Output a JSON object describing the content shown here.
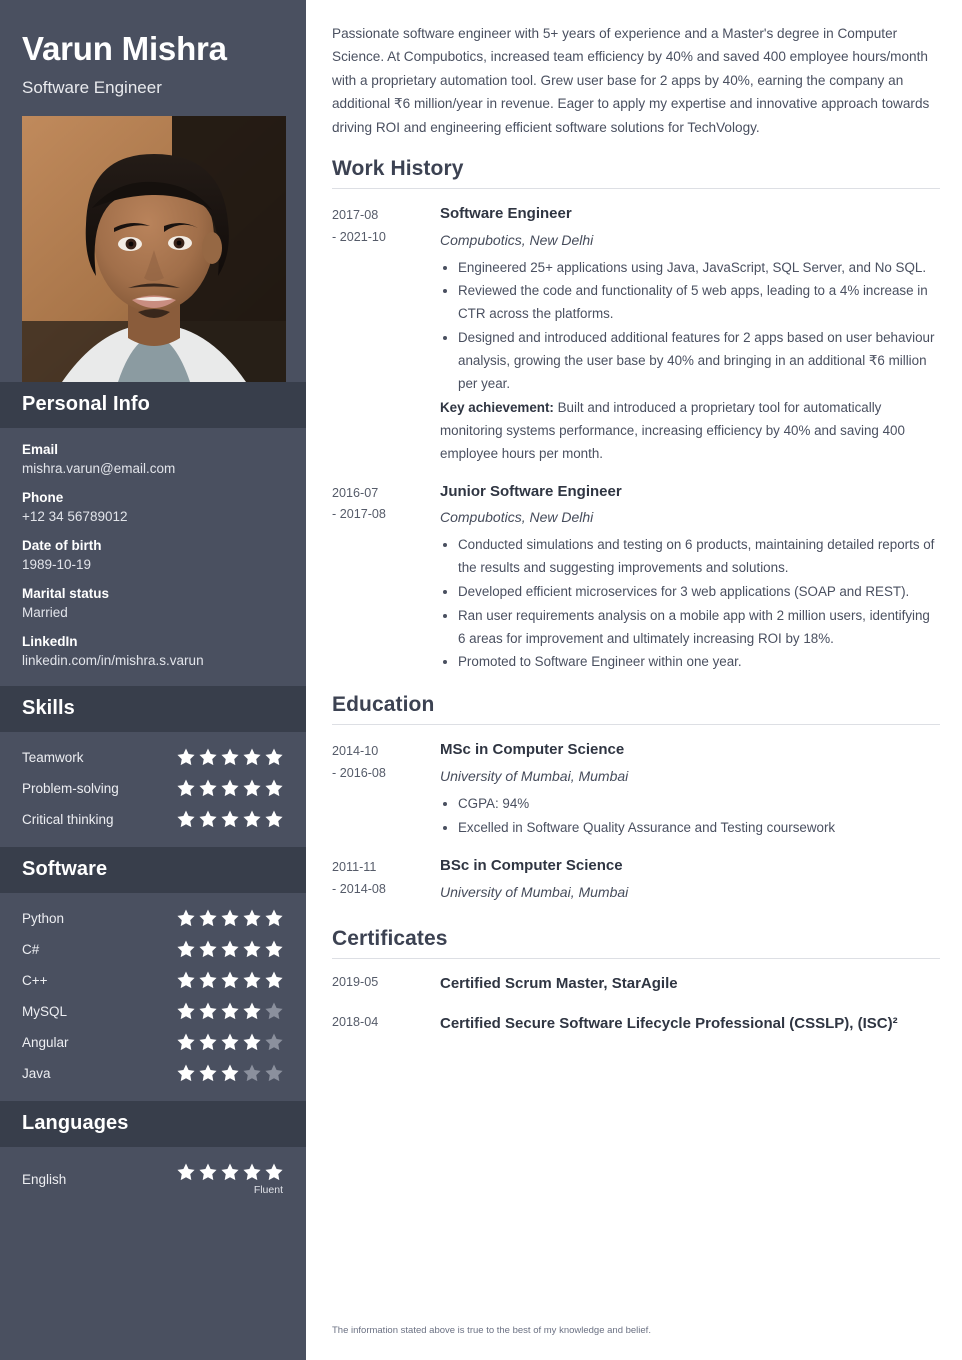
{
  "colors": {
    "sidebar_bg": "#4a5060",
    "sidebar_header_bg": "#383e4b",
    "text_dark": "#3c4252",
    "star_filled": "#ffffff",
    "star_empty": "#8b909d",
    "rule": "#dddfe4"
  },
  "header": {
    "name": "Varun Mishra",
    "job_title": "Software Engineer",
    "photo_alt": "portrait-photo"
  },
  "sidebar": {
    "personal_info": {
      "heading": "Personal Info",
      "items": [
        {
          "label": "Email",
          "value": "mishra.varun@email.com"
        },
        {
          "label": "Phone",
          "value": "+12 34 56789012"
        },
        {
          "label": "Date of birth",
          "value": "1989-10-19"
        },
        {
          "label": "Marital status",
          "value": "Married"
        },
        {
          "label": "LinkedIn",
          "value": "linkedin.com/in/mishra.s.varun"
        }
      ]
    },
    "skills": {
      "heading": "Skills",
      "items": [
        {
          "label": "Teamwork",
          "rating": 5,
          "max": 5
        },
        {
          "label": "Problem-solving",
          "rating": 5,
          "max": 5
        },
        {
          "label": "Critical thinking",
          "rating": 5,
          "max": 5
        }
      ]
    },
    "software": {
      "heading": "Software",
      "items": [
        {
          "label": "Python",
          "rating": 5,
          "max": 5
        },
        {
          "label": "C#",
          "rating": 5,
          "max": 5
        },
        {
          "label": "C++",
          "rating": 5,
          "max": 5
        },
        {
          "label": "MySQL",
          "rating": 4,
          "max": 5
        },
        {
          "label": "Angular",
          "rating": 4,
          "max": 5
        },
        {
          "label": "Java",
          "rating": 3,
          "max": 5
        }
      ]
    },
    "languages": {
      "heading": "Languages",
      "items": [
        {
          "label": "English",
          "rating": 5,
          "max": 5,
          "fluency": "Fluent"
        }
      ]
    }
  },
  "main": {
    "summary": "Passionate software engineer with 5+ years of experience and a Master's degree in Computer Science. At Compubotics, increased team efficiency by 40% and saved 400 employee hours/month with a proprietary automation tool. Grew user base for 2 apps by 40%, earning the company an additional ₹6 million/year in revenue. Eager to apply my expertise and innovative approach towards driving ROI and engineering efficient software solutions for TechVology.",
    "work_history": {
      "heading": "Work History",
      "entries": [
        {
          "date_start": "2017-08",
          "date_end": "- 2021-10",
          "role": "Software Engineer",
          "org": "Compubotics, New Delhi",
          "bullets": [
            "Engineered 25+ applications using Java, JavaScript, SQL Server, and No SQL.",
            "Reviewed the code and functionality of 5 web apps, leading to a 4% increase in CTR across the platforms.",
            "Designed and introduced additional features for 2 apps based on user behaviour analysis, growing the user base by 40% and bringing in an additional ₹6 million per year."
          ],
          "key_achievement_label": "Key achievement:",
          "key_achievement_text": " Built and introduced a proprietary tool for automatically monitoring systems performance, increasing efficiency by 40% and saving 400 employee hours per month."
        },
        {
          "date_start": "2016-07",
          "date_end": "- 2017-08",
          "role": "Junior Software Engineer",
          "org": "Compubotics, New Delhi",
          "bullets": [
            "Conducted simulations and testing on 6 products, maintaining detailed reports of the results and suggesting improvements and solutions.",
            "Developed efficient microservices for 3 web applications (SOAP and REST).",
            "Ran user requirements analysis on a mobile app with 2 million users, identifying 6 areas for improvement and ultimately increasing ROI by 18%.",
            "Promoted to Software Engineer within one year."
          ]
        }
      ]
    },
    "education": {
      "heading": "Education",
      "entries": [
        {
          "date_start": "2014-10",
          "date_end": "- 2016-08",
          "role": "MSc in Computer Science",
          "org": "University of Mumbai, Mumbai",
          "bullets": [
            "CGPA: 94%",
            "Excelled in Software Quality Assurance and Testing coursework"
          ]
        },
        {
          "date_start": "2011-11",
          "date_end": "- 2014-08",
          "role": "BSc in Computer Science",
          "org": "University of Mumbai, Mumbai",
          "bullets": []
        }
      ]
    },
    "certificates": {
      "heading": "Certificates",
      "entries": [
        {
          "date": "2019-05",
          "name": "Certified Scrum Master, StarAgile"
        },
        {
          "date": "2018-04",
          "name": "Certified Secure Software Lifecycle Professional (CSSLP), (ISC)²"
        }
      ]
    },
    "disclaimer": "The information stated above is true to the best of my knowledge and belief."
  }
}
